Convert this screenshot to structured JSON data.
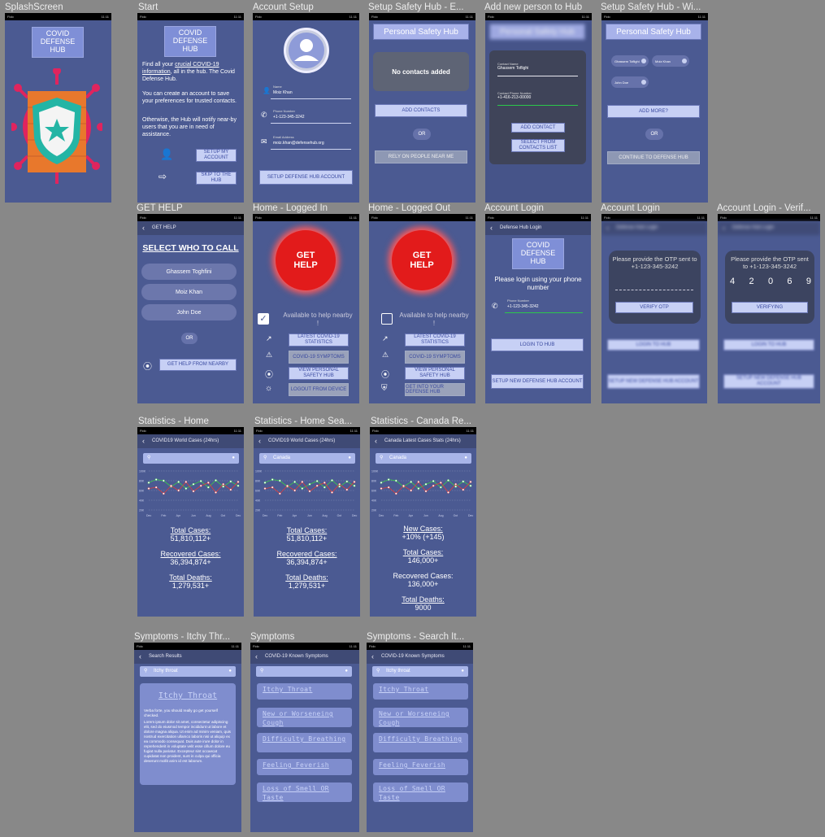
{
  "frames": {
    "splash": {
      "title": "SplashScreen",
      "logo": "COVID DEFENSE HUB"
    },
    "start": {
      "title": "Start",
      "logo": "COVID DEFENSE HUB",
      "intro_link": "crucial COVID-19 information",
      "intro_pre": "Find all your ",
      "intro_post": ", all in the hub. The Covid Defense Hub.",
      "p2": "You can create an account to save your preferences for trusted contacts.",
      "p3": "Otherwise, the Hub will notify near-by users that you are in need of assistance.",
      "btn_setup": "SETUP MY ACCOUNT",
      "btn_skip": "SKIP TO THE HUB"
    },
    "account_setup": {
      "title": "Account Setup",
      "name_label": "Name",
      "name_value": "Moiz Khan",
      "phone_label": "Phone Number",
      "phone_value": "+1-123-345-3242",
      "email_label": "Email Address",
      "email_value": "moiz.khan@defensehub.org",
      "btn": "SETUP DEFENSE HUB ACCOUNT"
    },
    "safety_empty": {
      "title": "Setup Safety Hub - E...",
      "header": "Personal Safety Hub",
      "empty": "No contacts added",
      "btn_add": "ADD CONTACTS",
      "or": "OR",
      "btn_rely": "RELY ON PEOPLE NEAR ME"
    },
    "add_person": {
      "title": "Add new person to Hub",
      "header": "Personal Safety Hub",
      "contact_label": "Contact Name",
      "contact_value": "Ghassem Toflighi",
      "phone_label": "Contact Phone Number",
      "phone_value": "+1-416-213-00000",
      "btn_add": "ADD CONTACT",
      "btn_select": "SELECT FROM CONTACTS LIST"
    },
    "safety_with": {
      "title": "Setup Safety Hub - Wi...",
      "header": "Personal Safety Hub",
      "pills": [
        "Ghassem Toflighi",
        "Moiz Khan",
        "John Doe"
      ],
      "btn_more": "ADD MORE?",
      "or": "OR",
      "btn_continue": "CONTINUE TO DEFENSE HUB"
    },
    "get_help": {
      "title": "GET HELP",
      "bar": "GET HELP",
      "heading": "SELECT WHO TO CALL",
      "contacts": [
        "Ghassem Toghfini",
        "Moiz Khan",
        "John Doe"
      ],
      "or": "OR",
      "btn_nearby": "GET HELP FROM NEARBY"
    },
    "home_in": {
      "title": "Home - Logged In",
      "help_btn": "GET HELP",
      "available": "Available to help nearby !",
      "menu": [
        "LATEST COVID-19 STATISTICS",
        "COVID-19 SYMPTOMS",
        "VIEW PERSONAL SAFETY HUB",
        "LOGOUT FROM DEVICE"
      ]
    },
    "home_out": {
      "title": "Home - Logged Out",
      "help_btn": "GET HELP",
      "available": "Available to help nearby !",
      "menu": [
        "LATEST COVID-19 STATISTICS",
        "COVID-19 SYMPTOMS",
        "VIEW PERSONAL SAFETY HUB",
        "GET INTO YOUR DEFENSE HUB"
      ]
    },
    "login": {
      "title": "Account Login",
      "bar": "Defense Hub Login",
      "logo": "COVID DEFENSE HUB",
      "prompt": "Please login using your phone number",
      "phone_label": "Phone Number",
      "phone_value": "+1-123-345-3242",
      "btn_login": "LOGIN TO HUB",
      "btn_setup": "SETUP NEW DEFENSE HUB ACCOUNT"
    },
    "otp": {
      "title": "Account Login",
      "prompt": "Please provide the OTP sent to +1-123-345-3242",
      "btn": "VERIFY OTP",
      "bg_login": "LOGIN TO HUB",
      "bg_setup": "SETUP NEW DEFENSE HUB ACCOUNT"
    },
    "otp_verify": {
      "title": "Account Login - Verif...",
      "prompt": "Please provide the OTP sent to +1-123-345-3242",
      "digits": [
        "4",
        "2",
        "0",
        "6",
        "9"
      ],
      "btn": "VERIFYING",
      "bg_login": "LOGIN TO HUB",
      "bg_setup": "SETUP NEW DEFENSE HUB ACCOUNT"
    },
    "stats_home": {
      "title": "Statistics - Home",
      "bar": "COVID19 World Cases (24hrs)",
      "search": "",
      "stats": [
        [
          "Total Cases:",
          "51,810,112+"
        ],
        [
          "Recovered Cases:",
          "36,394,874+"
        ],
        [
          "Total Deaths:",
          "1,279,531+"
        ]
      ]
    },
    "stats_search": {
      "title": "Statistics - Home Sea...",
      "bar": "COVID19 World Cases (24hrs)",
      "search": "Canada",
      "stats": [
        [
          "Total Cases:",
          "51,810,112+"
        ],
        [
          "Recovered Cases:",
          "36,394,874+"
        ],
        [
          "Total Deaths:",
          "1,279,531+"
        ]
      ]
    },
    "stats_canada": {
      "title": "Statistics - Canada Re...",
      "bar": "Canada Latest Cases Stats (24hrs)",
      "search": "Canada",
      "stats": [
        [
          "New Cases:",
          "+10% (+145)"
        ],
        [
          "Total Cases:",
          "146,000+"
        ],
        [
          "Recovered Cases:",
          "136,000+"
        ],
        [
          "Total Deaths:",
          "9000"
        ]
      ]
    },
    "sym_itchy": {
      "title": "Symptoms - Itchy Thr...",
      "bar": "Search Results",
      "search": "Itchy throat",
      "card_title": "Itchy Throat",
      "card_lead": "Verba forte, you should really go get yourself checked.",
      "card_body": "Lorem ipsum dolor sit amet, consectetur adipiscing elit, sed do eiusmod tempor incididunt ut labore et dolore magna aliqua. Ut enim ad minim veniam, quis nostrud exercitation ullamco laboris nisi ut aliquip ex ea commodo consequat. Duis aute irure dolor in reprehenderit in voluptate velit esse cillum dolore eu fugiat nulla pariatur. Excepteur sint occaecat cupidatat non proident, sunt in culpa qui officia deserunt mollit anim id est laborum."
    },
    "symptoms": {
      "title": "Symptoms",
      "bar": "COVID-19 Known Symptoms",
      "search": "",
      "items": [
        "Itchy Throat",
        "New or Worseneing Cough",
        "Difficulty Breathing",
        "Feeling Feverish",
        "Loss of Smell OR Taste"
      ]
    },
    "sym_search": {
      "title": "Symptoms - Search It...",
      "bar": "COVID-19 Known Symptoms",
      "search": "Itchy throat",
      "items": [
        "Itchy Throat",
        "New or Worseneing Cough",
        "Difficulty Breathing",
        "Feeling Feverish",
        "Loss of Smell OR Taste"
      ]
    }
  },
  "status": {
    "carrier": "Fido",
    "time": "11:11"
  },
  "chart_data": {
    "type": "line",
    "x": [
      "Dec",
      "Jan",
      "Feb",
      "Mar",
      "Apr",
      "May",
      "Jun",
      "Jul",
      "Aug",
      "Sep",
      "Oct",
      "Nov",
      "Dec"
    ],
    "ylim": [
      0,
      100
    ],
    "yticks": [
      "100K",
      "80K",
      "60K",
      "40K",
      "20K"
    ],
    "series": [
      {
        "values": [
          70,
          78,
          75,
          60,
          72,
          55,
          66,
          74,
          58,
          76,
          60,
          73,
          62
        ]
      },
      {
        "values": [
          55,
          58,
          42,
          62,
          50,
          72,
          48,
          62,
          70,
          45,
          66,
          52,
          72
        ]
      }
    ]
  }
}
